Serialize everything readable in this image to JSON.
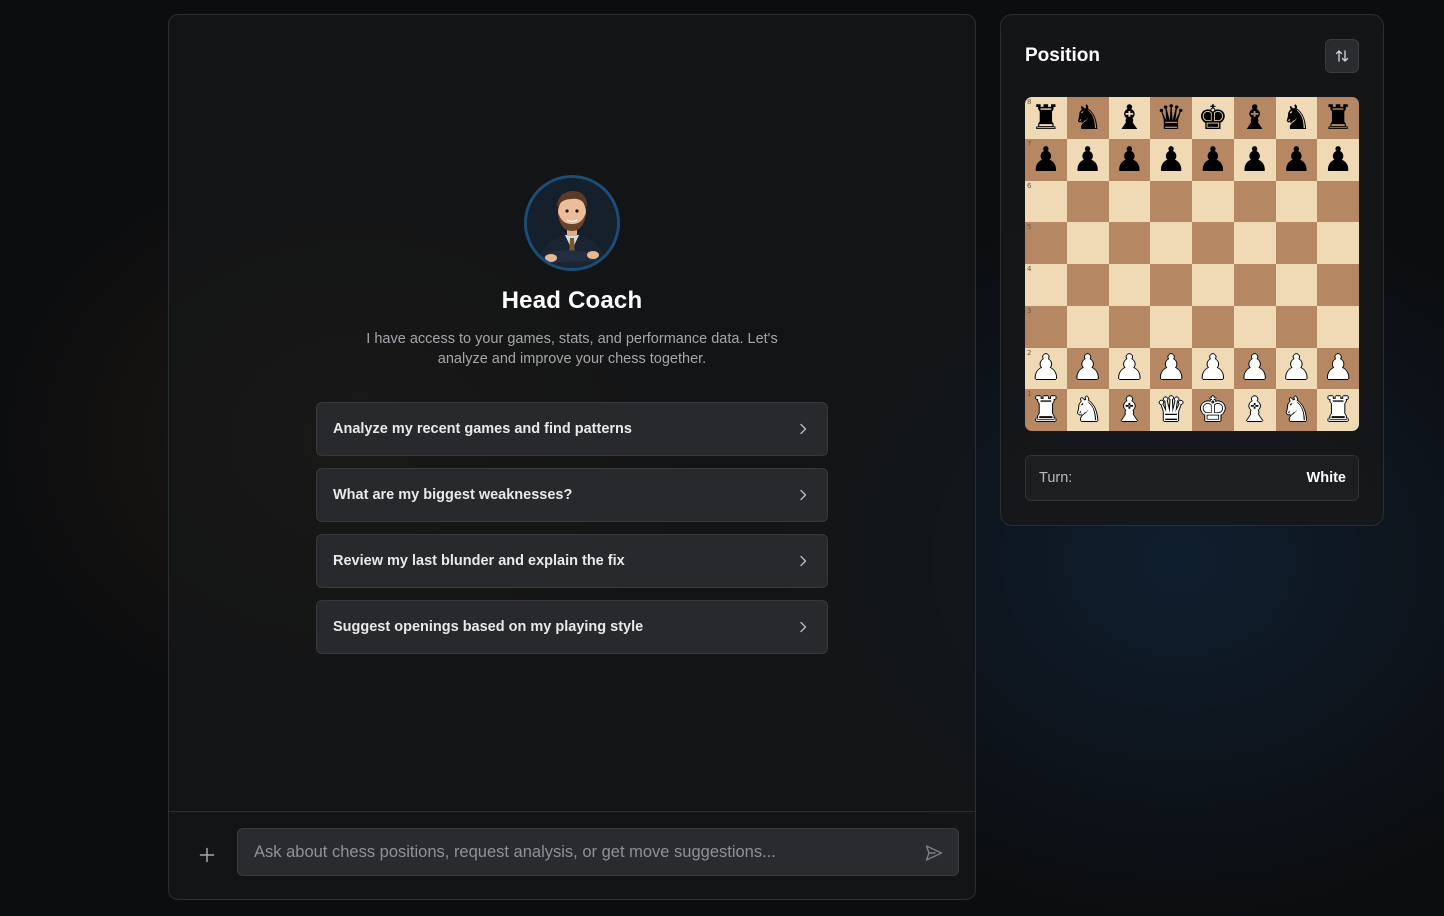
{
  "coach": {
    "name": "Head Coach",
    "description": "I have access to your games, stats, and performance data. Let's analyze and improve your chess together."
  },
  "suggestions": [
    {
      "label": "Analyze my recent games and find patterns"
    },
    {
      "label": "What are my biggest weaknesses?"
    },
    {
      "label": "Review my last blunder and explain the fix"
    },
    {
      "label": "Suggest openings based on my playing style"
    }
  ],
  "composer": {
    "placeholder": "Ask about chess positions, request analysis, or get move suggestions..."
  },
  "position": {
    "title": "Position",
    "turn_label": "Turn:",
    "turn_value": "White",
    "board": [
      [
        "bR",
        "bN",
        "bB",
        "bQ",
        "bK",
        "bB",
        "bN",
        "bR"
      ],
      [
        "bP",
        "bP",
        "bP",
        "bP",
        "bP",
        "bP",
        "bP",
        "bP"
      ],
      [
        "",
        "",
        "",
        "",
        "",
        "",
        "",
        ""
      ],
      [
        "",
        "",
        "",
        "",
        "",
        "",
        "",
        ""
      ],
      [
        "",
        "",
        "",
        "",
        "",
        "",
        "",
        ""
      ],
      [
        "",
        "",
        "",
        "",
        "",
        "",
        "",
        ""
      ],
      [
        "wP",
        "wP",
        "wP",
        "wP",
        "wP",
        "wP",
        "wP",
        "wP"
      ],
      [
        "wR",
        "wN",
        "wB",
        "wQ",
        "wK",
        "wB",
        "wN",
        "wR"
      ]
    ],
    "rank_labels": [
      "8",
      "7",
      "6",
      "5",
      "4",
      "3",
      "2",
      "1"
    ]
  },
  "colors": {
    "light_square": "#f0d9b5",
    "dark_square": "#b58863",
    "avatar_ring": "#1c4d7a"
  },
  "icons": {
    "add": "plus-icon",
    "send": "send-icon",
    "flip": "swap-vertical-icon",
    "suggestion": "chevron-right-icon"
  }
}
